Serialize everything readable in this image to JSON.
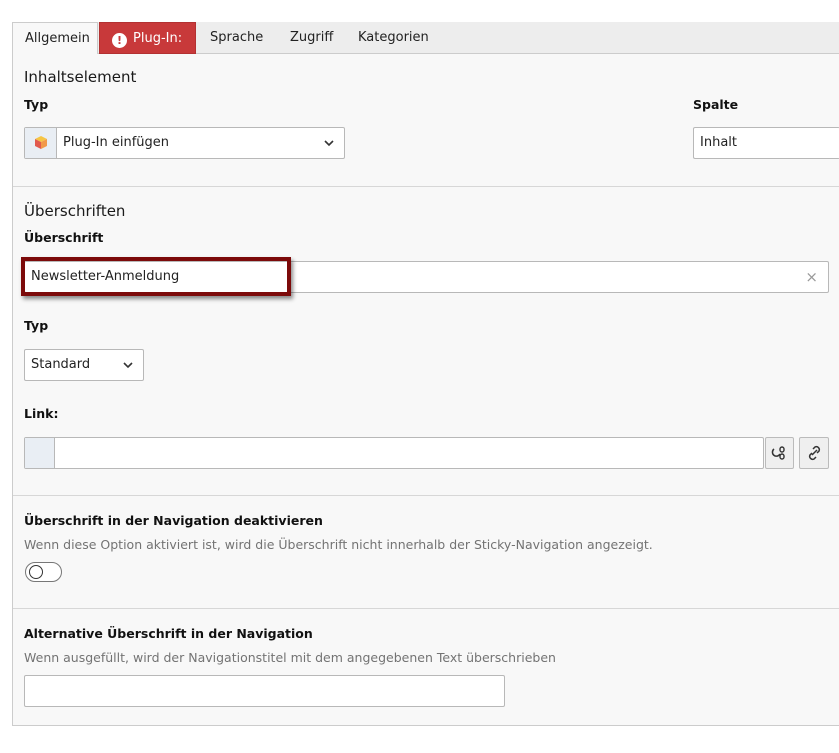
{
  "tabs": [
    {
      "label": "Allgemein"
    },
    {
      "label": "Plug-In:"
    },
    {
      "label": "Sprache"
    },
    {
      "label": "Zugriff"
    },
    {
      "label": "Kategorien"
    }
  ],
  "tab_error_icon": "!",
  "sections": {
    "content": {
      "title": "Inhaltselement",
      "type_label": "Typ",
      "type_value": "Plug-In einfügen",
      "type_icon": "cube-icon",
      "column_label": "Spalte",
      "column_value": "Inhalt"
    },
    "headings": {
      "title": "Überschriften",
      "heading_label": "Überschrift",
      "heading_value": "Newsletter-Anmeldung",
      "clear_symbol": "×",
      "type_label": "Typ",
      "type_value": "Standard",
      "link_label": "Link:",
      "link_value": ""
    },
    "nav_disable": {
      "label": "Überschrift in der Navigation deaktivieren",
      "description": "Wenn diese Option aktiviert ist, wird die Überschrift nicht innerhalb der Sticky-Navigation angezeigt.",
      "enabled": false
    },
    "nav_alt": {
      "label": "Alternative Überschrift in der Navigation",
      "description": "Wenn ausgefüllt, wird der Navigationstitel mit dem angegebenen Text überschrieben",
      "value": ""
    }
  },
  "colors": {
    "error_tab": "#c8393a",
    "highlight_border": "#7c0a0a",
    "panel_bg": "#f8f8f8"
  }
}
